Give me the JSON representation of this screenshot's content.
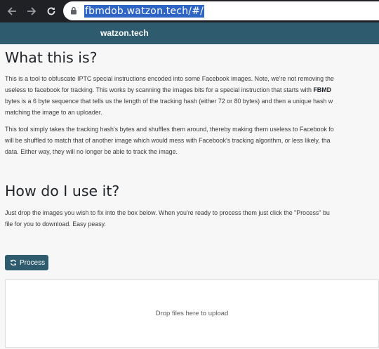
{
  "browser": {
    "url": "fbmdob.watzon.tech/#/"
  },
  "navbar": {
    "brand": "watzon.tech"
  },
  "sections": {
    "what": {
      "heading": "What this is?",
      "p1_lines": [
        "This is a tool to obfuscate IPTC special instructions encoded into some Facebook images. Note, we're not removing the",
        "useless to facebook for tracking. This works by scanning the images bits for a special instruction that starts with ",
        "bytes is a 6 byte sequence that tells us the length of the tracking hash (either 72 or 80 bytes) and then a unique hash w",
        "matching the image to an uploader."
      ],
      "p1_bold": "FBMD",
      "p2_lines": [
        "This tool simply takes the tracking hash's bytes and shuffles them around, thereby making them useless to Facebook fo",
        "will be shuffled to match that of another image which would mess with Facebook's tracking algorithm, or less likely, tha",
        "data. Either way, they will no longer be able to track the image."
      ]
    },
    "how": {
      "heading": "How do I use it?",
      "p_lines": [
        "Just drop the images you wish to fix into the box below. When you're ready to process them just click the \"Process\" bu",
        "file for you to download. Easy peasy."
      ]
    }
  },
  "actions": {
    "process_label": "Process"
  },
  "dropzone": {
    "text": "Drop files here to upload"
  },
  "colors": {
    "primary": "#2e5b6e",
    "chrome": "#202124",
    "url_highlight": "#2f64c7"
  },
  "icons": {
    "back": "arrow-left-icon",
    "forward": "arrow-right-icon",
    "reload": "reload-icon",
    "lock": "lock-icon",
    "process": "sync-icon"
  }
}
